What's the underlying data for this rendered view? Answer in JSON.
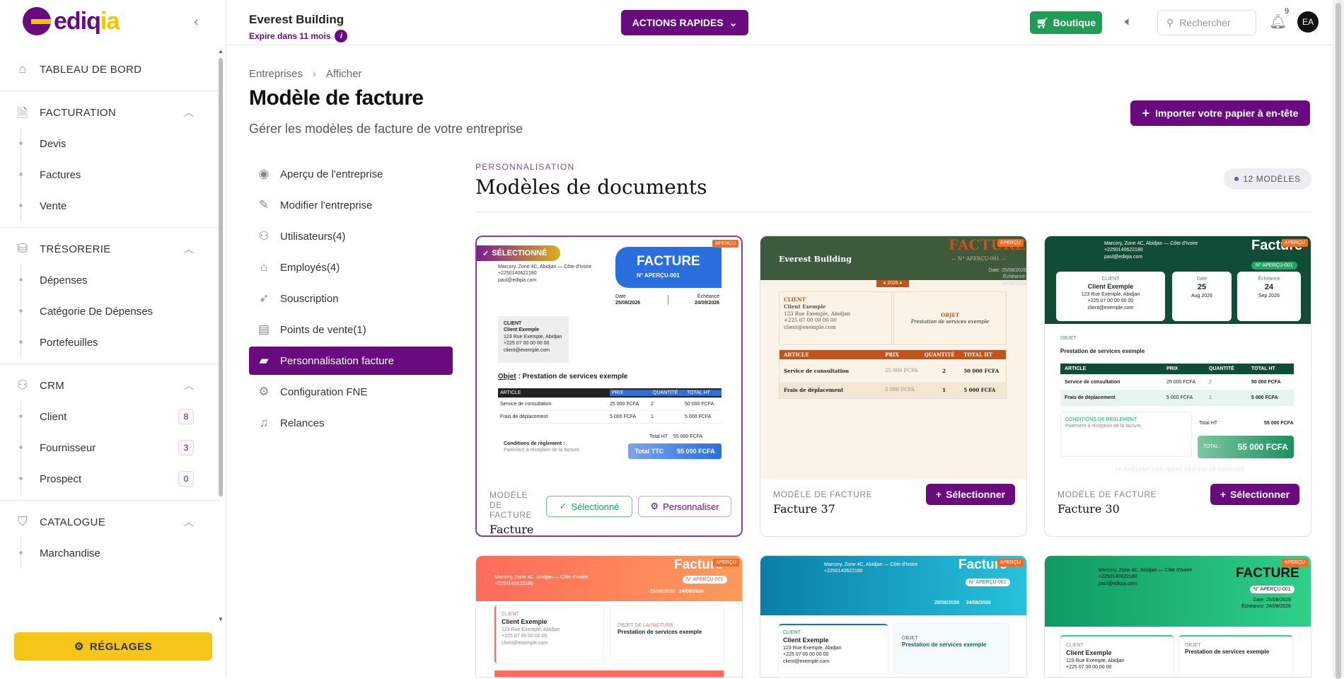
{
  "app": {
    "logo_text": "ediqia",
    "company_name": "Everest Building",
    "expiry": "Expire dans 11 mois",
    "actions_label": "ACTIONS RAPIDES",
    "boutique_label": "Boutique",
    "search_placeholder": "Rechercher",
    "notif_count": "9",
    "avatar": "EA",
    "brand_color": "#6a0a7f",
    "accent_color": "#f5c518"
  },
  "sidebar": {
    "dashboard": "TABLEAU DE BORD",
    "sections": [
      {
        "title": "FACTURATION",
        "items": [
          {
            "label": "Devis"
          },
          {
            "label": "Factures"
          },
          {
            "label": "Vente"
          }
        ]
      },
      {
        "title": "TRÉSORERIE",
        "items": [
          {
            "label": "Dépenses"
          },
          {
            "label": "Catégorie De Dépenses"
          },
          {
            "label": "Portefeuilles"
          }
        ]
      },
      {
        "title": "CRM",
        "items": [
          {
            "label": "Client",
            "badge": "8"
          },
          {
            "label": "Fournisseur",
            "badge": "3"
          },
          {
            "label": "Prospect",
            "badge": "0"
          }
        ]
      },
      {
        "title": "CATALOGUE",
        "items": [
          {
            "label": "Marchandise"
          }
        ]
      }
    ],
    "settings_label": "RÉGLAGES"
  },
  "page": {
    "breadcrumb": [
      "Entreprises",
      "Afficher"
    ],
    "title": "Modèle de facture",
    "subtitle": "Gérer les modèles de facture de votre entreprise",
    "import_label": "Importer votre papier à en-tête"
  },
  "menu": [
    {
      "label": "Aperçu de l'entreprise",
      "icon": "eye-icon"
    },
    {
      "label": "Modifier l'entreprise",
      "icon": "edit-icon"
    },
    {
      "label": "Utilisateurs(4)",
      "icon": "users-icon"
    },
    {
      "label": "Employés(4)",
      "icon": "home-user-icon"
    },
    {
      "label": "Souscription",
      "icon": "rocket-icon"
    },
    {
      "label": "Points de vente(1)",
      "icon": "store-icon"
    },
    {
      "label": "Personnalisation facture",
      "icon": "paint-roller-icon",
      "active": true
    },
    {
      "label": "Configuration FNE",
      "icon": "gear-icon"
    },
    {
      "label": "Relances",
      "icon": "bell-icon"
    }
  ],
  "templates": {
    "kicker": "PERSONNALISATION",
    "title": "Modèles de documents",
    "count": "12 MODÈLES",
    "type_label": "MODÈLE DE FACTURE",
    "select_label": "Sélectionner",
    "selected_label": "Sélectionné",
    "customize_label": "Personnaliser",
    "selected_badge": "SÉLECTIONNÉ",
    "preview_badge": "APERÇU",
    "cards": [
      {
        "name": "Facture 1"
      },
      {
        "name": "Facture 37"
      },
      {
        "name": "Facture 30"
      }
    ]
  },
  "sample": {
    "facture": "FACTURE",
    "facture_title": "Facture",
    "numero": "N° APERÇU-001",
    "numero_alt": "— N° APERÇU-001 —",
    "company": "Everest Building",
    "address": "Marcory, Zone 4C, Abidjan — Côte d'Ivoire",
    "address_short": "Marcory, Zone 4C, Abidjan — Côte d'Ivoire",
    "phone": "+2250140622180",
    "email": "paul@ediqia.com",
    "date_label": "Date",
    "due_label": "Échéance",
    "date": "25/08/2026",
    "due": "24/09/2026",
    "date_day": "25",
    "date_month": "Aug 2026",
    "due_day": "24",
    "due_month": "Sep 2026",
    "year_tag": "♦ 2026 ♦",
    "client_label": "CLIENT",
    "client_name": "Client Exemple",
    "client_address": "123 Rue Exemple, Abidjan",
    "client_phone": "+225 07 00 00 00 00",
    "client_email": "client@exemple.com",
    "object_label": "Objet",
    "object_caps": "OBJET",
    "object_label_long": "OBJET DE LA FACTURE",
    "object": "Prestation de services exemple",
    "col_article": "ARTICLE",
    "col_price": "PRIX",
    "col_qty": "QUANTITÉ",
    "col_total": "TOTAL HT",
    "line1": "Service de consultation",
    "line1_price": "25 000 FCFA",
    "line1_qty": "2",
    "line1_total": "50 000 FCFA",
    "line2": "Frais de déplacement",
    "line2_price": "5 000 FCFA",
    "line2_qty": "1",
    "line2_total": "5 000 FCFA",
    "conditions_label": "Conditions de règlement :",
    "conditions_caps": "CONDITIONS DE RÈGLEMENT",
    "conditions": "Paiement à réception de la facture.",
    "total_ht_label": "Total HT",
    "total_ht": "55 000 FCFA",
    "total_ttc_label": "Total TTC",
    "total_label": "TOTAL :",
    "total_ttc": "55 000 FCFA",
    "footer_note": "LE PRÉSENT DOCUMENT FAIT FOI DE CONTRAT"
  }
}
